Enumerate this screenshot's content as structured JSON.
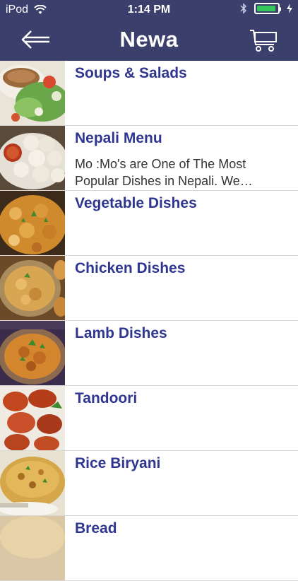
{
  "status_bar": {
    "carrier": "iPod",
    "time": "1:14 PM"
  },
  "nav": {
    "title": "Newa",
    "back_icon": "arrow-left-icon",
    "cart_icon": "shopping-cart-icon"
  },
  "colors": {
    "header_bg": "#3b3f6b",
    "item_title": "#2f3690",
    "battery": "#34c759"
  },
  "categories": [
    {
      "title": "Soups & Salads",
      "desc_line1": "",
      "desc_line2": ""
    },
    {
      "title": "Nepali Menu",
      "desc_line1": "Mo :Mo's are One of The Most",
      "desc_line2": "Popular Dishes in Nepali. We…"
    },
    {
      "title": "Vegetable Dishes",
      "desc_line1": "",
      "desc_line2": ""
    },
    {
      "title": "Chicken Dishes",
      "desc_line1": "",
      "desc_line2": ""
    },
    {
      "title": "Lamb Dishes",
      "desc_line1": "",
      "desc_line2": ""
    },
    {
      "title": "Tandoori",
      "desc_line1": "",
      "desc_line2": ""
    },
    {
      "title": "Rice Biryani",
      "desc_line1": "",
      "desc_line2": ""
    },
    {
      "title": "Bread",
      "desc_line1": "",
      "desc_line2": ""
    }
  ]
}
